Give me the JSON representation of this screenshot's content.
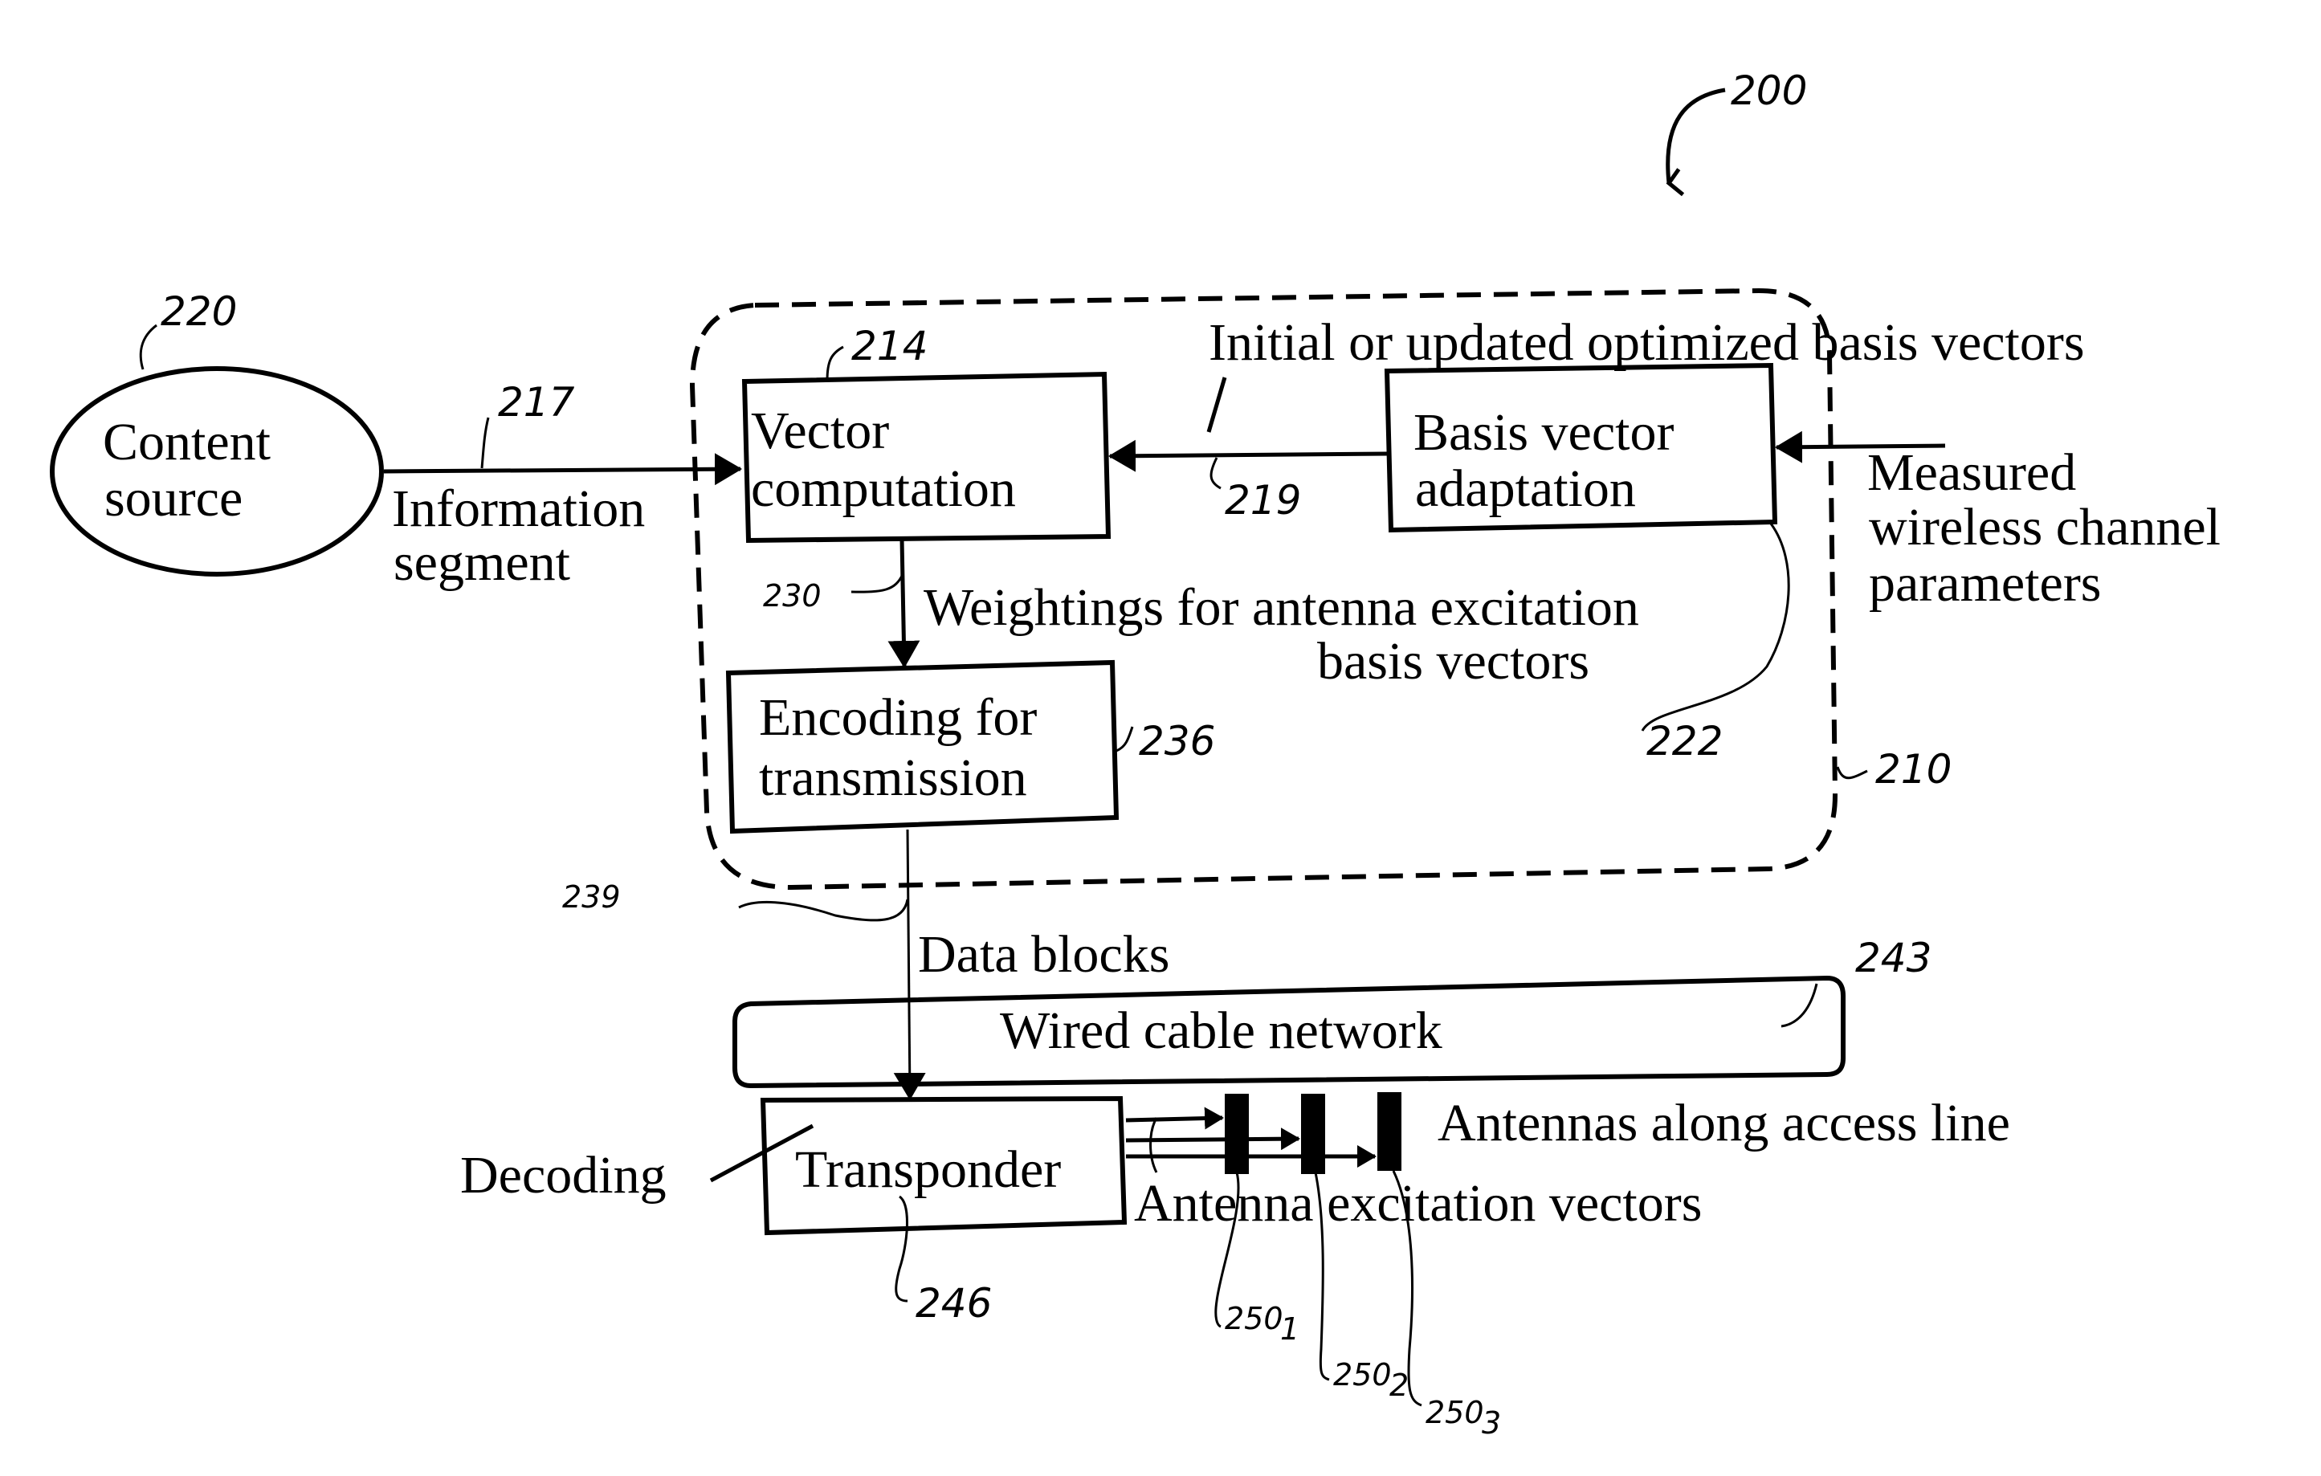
{
  "figure": {
    "reference_number": "200",
    "colors": {
      "ink": "#000000",
      "background": "#ffffff"
    }
  },
  "content_source": {
    "ref": "220",
    "line1": "Content",
    "line2": "source"
  },
  "information_segment": {
    "ref": "217",
    "line1": "Information",
    "line2": "segment"
  },
  "processing_block": {
    "ref": "210"
  },
  "vector_computation": {
    "ref": "214",
    "line1": "Vector",
    "line2": "computation"
  },
  "basis_vector_adaptation": {
    "ref": "222",
    "line1": "Basis vector",
    "line2": "adaptation"
  },
  "optimized_basis_link": {
    "ref": "219",
    "label": "Initial or updated optimized basis vectors"
  },
  "measured_input": {
    "line1": "Measured",
    "line2": "wireless channel",
    "line3": "parameters"
  },
  "weightings_link": {
    "ref": "230",
    "line1": "Weightings for antenna excitation",
    "line2": "basis vectors"
  },
  "encoding": {
    "ref": "236",
    "line1": "Encoding for",
    "line2": "transmission"
  },
  "data_blocks_link": {
    "ref": "239",
    "label": "Data blocks"
  },
  "wired_cable_network": {
    "ref": "243",
    "label": "Wired cable network"
  },
  "transponder": {
    "ref": "246",
    "label": "Transponder",
    "decoding_label": "Decoding"
  },
  "antennas": {
    "label": "Antennas along access line",
    "excitation_label": "Antenna excitation vectors",
    "refs": [
      "250",
      "250",
      "250"
    ],
    "subscripts": [
      "1",
      "2",
      "3"
    ]
  }
}
